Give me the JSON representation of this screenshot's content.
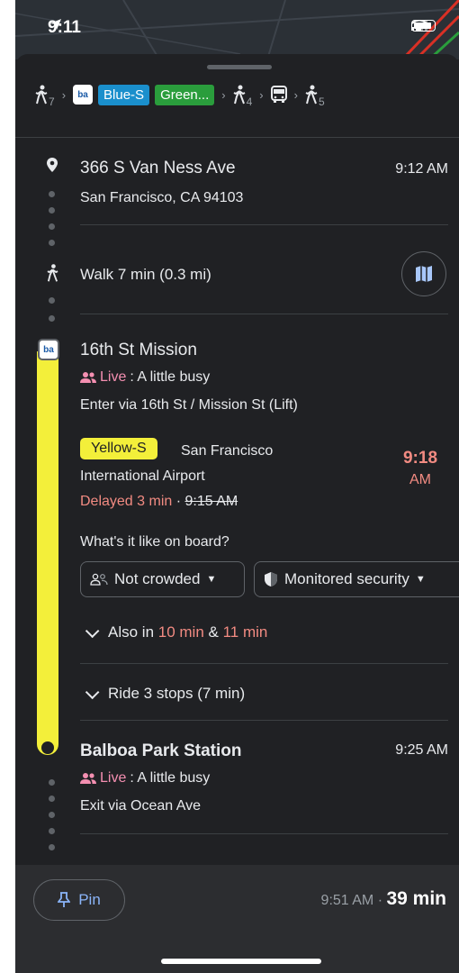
{
  "status_bar": {
    "time": "9:11"
  },
  "route_summary": {
    "walk_before": "7",
    "blue_line": "Blue-S",
    "green_line": "Green...",
    "walk_mid": "4",
    "walk_after": "5",
    "bart_logo_text": "ba"
  },
  "origin": {
    "address": "366 S Van Ness Ave",
    "time": "9:12 AM",
    "city": "San Francisco, CA 94103"
  },
  "walk": {
    "label": "Walk 7 min (0.3 mi)"
  },
  "station": {
    "name": "16th St Mission",
    "live_label": "Live",
    "crowd": ": A little busy",
    "entrance": "Enter via 16th St / Mission St (Lift)"
  },
  "train": {
    "line": "Yellow-S",
    "destination_1": "San Francisco",
    "destination_2": "International Airport",
    "delay": "Delayed 3 min",
    "sep": " · ",
    "original_time": "9:15 AM",
    "dep_time": "9:18",
    "dep_ampm": "AM",
    "onboard_question": "What's it like on board?",
    "crowded_pill": "Not crowded",
    "security_pill": "Monitored security",
    "also_prefix": "Also in ",
    "also_1": "10 min",
    "also_amp": " & ",
    "also_2": "11 min",
    "ride_label": "Ride 3 stops (7 min)"
  },
  "destination": {
    "name": "Balboa Park Station",
    "time": "9:25 AM",
    "live_label": "Live",
    "crowd": ": A little busy",
    "exit": "Exit via Ocean Ave"
  },
  "bottom": {
    "pin_label": "Pin",
    "arrival": "9:51 AM · ",
    "duration": "39 min"
  },
  "colors": {
    "yellow_line": "#f3ef3a",
    "blue_line": "#1a8fcc",
    "green_line": "#2a9d3c",
    "live": "#f48fb1",
    "delay": "#f28b82",
    "accent": "#8ab4f8"
  }
}
